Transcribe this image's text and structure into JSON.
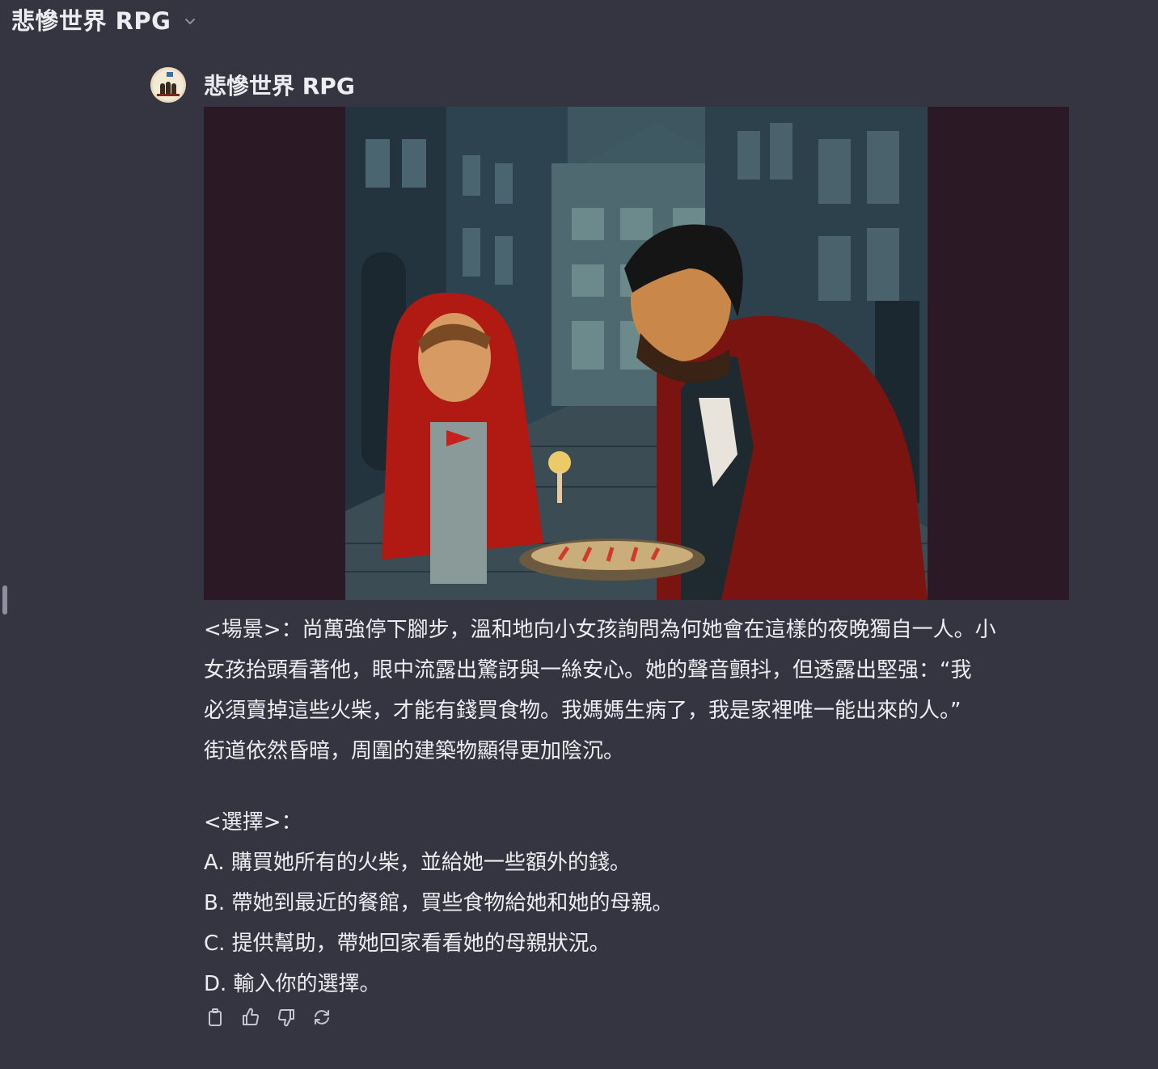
{
  "header": {
    "title": "悲慘世界 RPG"
  },
  "message": {
    "sender": "悲慘世界 RPG",
    "image_alt": "",
    "scene_lines": [
      "<場景>：尚萬強停下腳步，溫和地向小女孩詢問為何她會在這樣的夜晚獨自一人。小",
      "女孩抬頭看著他，眼中流露出驚訝與一絲安心。她的聲音顫抖，但透露出堅强：“我",
      "必須賣掉這些火柴，才能有錢買食物。我媽媽生病了，我是家裡唯一能出來的人。”",
      "街道依然昏暗，周圍的建築物顯得更加陰沉。"
    ],
    "choices_label": "<選擇>：",
    "choices": [
      "A. 購買她所有的火柴，並給她一些額外的錢。",
      "B. 帶她到最近的餐館，買些食物給她和她的母親。",
      "C. 提供幫助，帶她回家看看她的母親狀況。",
      "D. 輸入你的選擇。"
    ]
  },
  "actions": [
    "copy-icon",
    "thumbs-up-icon",
    "thumbs-down-icon",
    "regenerate-icon"
  ],
  "colors": {
    "background": "#343541",
    "text": "#ececf1",
    "icon": "#c5c5d2"
  }
}
